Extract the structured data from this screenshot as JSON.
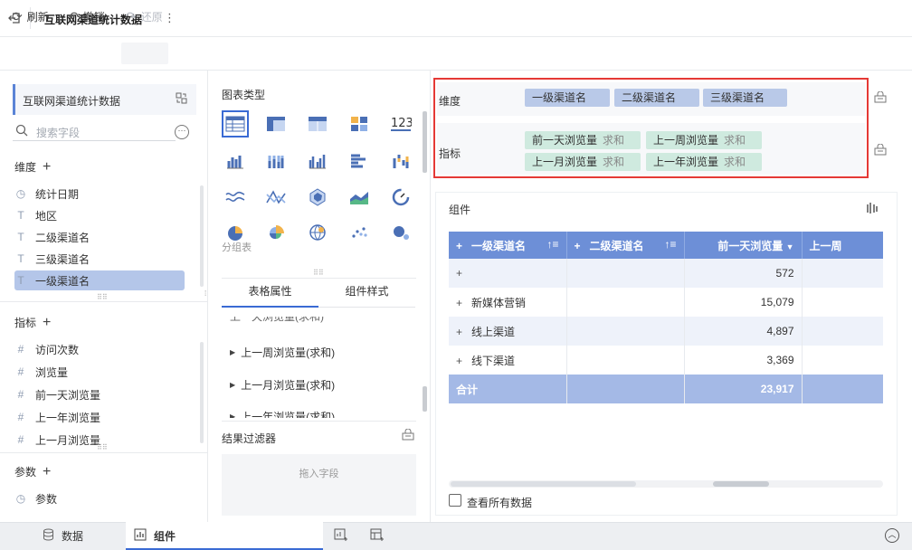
{
  "header": {
    "title": "互联网渠道统计数据"
  },
  "toolbar": {
    "refresh": "刷新",
    "undo": "撤销",
    "redo": "还原"
  },
  "left": {
    "dataset_name": "互联网渠道统计数据",
    "search_placeholder": "搜索字段",
    "dimension_title": "维度",
    "dimensions": [
      {
        "name": "统计日期",
        "type": "date"
      },
      {
        "name": "地区",
        "type": "text"
      },
      {
        "name": "二级渠道名",
        "type": "text"
      },
      {
        "name": "三级渠道名",
        "type": "text"
      },
      {
        "name": "一级渠道名",
        "type": "text"
      }
    ],
    "measure_title": "指标",
    "measures": [
      "访问次数",
      "浏览量",
      "前一天浏览量",
      "上一年浏览量",
      "上一月浏览量"
    ],
    "param_title": "参数",
    "params": [
      "参数"
    ]
  },
  "middle": {
    "chart_type_title": "图表类型",
    "group_table": "分组表",
    "tabs": [
      "表格属性",
      "组件样式"
    ],
    "props": [
      "上一周浏览量(求和)",
      "上一月浏览量(求和)",
      "上一年浏览量(求和)"
    ],
    "filter_title": "结果过滤器",
    "filter_placeholder": "拖入字段"
  },
  "config": {
    "dimension_label": "维度",
    "measure_label": "指标",
    "dimension_chips": [
      "一级渠道名",
      "二级渠道名",
      "三级渠道名"
    ],
    "measure_chips": [
      {
        "name": "前一天浏览量",
        "agg": "求和"
      },
      {
        "name": "上一周浏览量",
        "agg": "求和"
      },
      {
        "name": "上一月浏览量",
        "agg": "求和"
      },
      {
        "name": "上一年浏览量",
        "agg": "求和"
      }
    ]
  },
  "widget": {
    "title": "组件",
    "columns": [
      "一级渠道名",
      "二级渠道名",
      "前一天浏览量",
      "上一周"
    ],
    "rows": [
      {
        "c1": "",
        "value": "572"
      },
      {
        "c1": "新媒体营销",
        "value": "15,079"
      },
      {
        "c1": "线上渠道",
        "value": "4,897"
      },
      {
        "c1": "线下渠道",
        "value": "3,369"
      }
    ],
    "total_label": "合计",
    "total_value": "23,917",
    "view_all": "查看所有数据"
  },
  "bottom": {
    "tabs": [
      "数据",
      "组件"
    ]
  },
  "colors": {
    "accent": "#3a6bd4",
    "header_blue": "#6d8fd7",
    "highlight_red": "#e53935"
  }
}
